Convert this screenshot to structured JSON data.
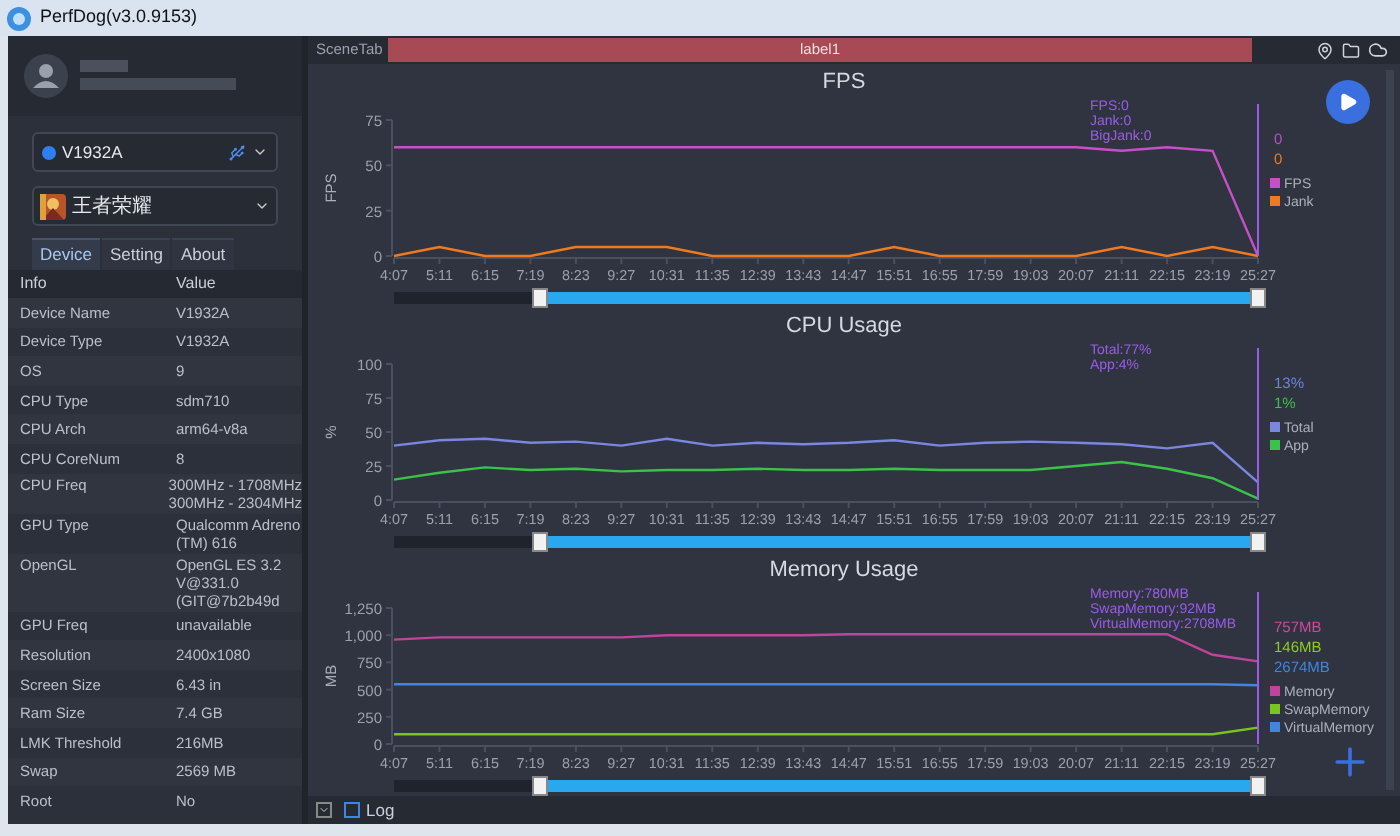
{
  "window": {
    "title": "PerfDog(v3.0.9153)"
  },
  "sidebar": {
    "device_selector": {
      "label": "V1932A"
    },
    "app_selector": {
      "label": "王者荣耀"
    },
    "tabs": [
      {
        "label": "Device",
        "selected": true
      },
      {
        "label": "Setting",
        "selected": false
      },
      {
        "label": "About",
        "selected": false
      }
    ],
    "table": {
      "columns": [
        "Info",
        "Value"
      ],
      "rows": [
        {
          "label": "Device Name",
          "value": [
            "V1932A"
          ]
        },
        {
          "label": "Device Type",
          "value": [
            "V1932A"
          ]
        },
        {
          "label": "OS",
          "value": [
            "9"
          ]
        },
        {
          "label": "CPU Type",
          "value": [
            "sdm710"
          ]
        },
        {
          "label": "CPU Arch",
          "value": [
            "arm64-v8a"
          ]
        },
        {
          "label": "CPU CoreNum",
          "value": [
            "8"
          ]
        },
        {
          "label": "CPU Freq",
          "value": [
            "300MHz - 1708MHz",
            "300MHz - 2304MHz"
          ]
        },
        {
          "label": "GPU Type",
          "value": [
            "Qualcomm Adreno",
            "(TM) 616"
          ]
        },
        {
          "label": "OpenGL",
          "value": [
            "OpenGL ES 3.2",
            "V@331.0",
            "(GIT@7b2b49d"
          ]
        },
        {
          "label": "GPU Freq",
          "value": [
            "unavailable"
          ]
        },
        {
          "label": "Resolution",
          "value": [
            "2400x1080"
          ]
        },
        {
          "label": "Screen Size",
          "value": [
            "6.43 in"
          ]
        },
        {
          "label": "Ram Size",
          "value": [
            "7.4 GB"
          ]
        },
        {
          "label": "LMK Threshold",
          "value": [
            "216MB"
          ]
        },
        {
          "label": "Swap",
          "value": [
            "2569 MB"
          ]
        },
        {
          "label": "Root",
          "value": [
            "No"
          ]
        }
      ]
    }
  },
  "scene_bar": {
    "tab": "SceneTab",
    "label": "label1"
  },
  "charts": [
    {
      "current_values": [
        {
          "text": "0",
          "color": "#b54fd0"
        },
        {
          "text": "0",
          "color": "#f07a22"
        }
      ],
      "slider": {
        "level": 0.83
      },
      "chart_data": {
        "type": "line",
        "title": "FPS",
        "ylabel": "FPS",
        "categories": [
          "4:07",
          "5:11",
          "6:15",
          "7:19",
          "8:23",
          "9:27",
          "10:31",
          "11:35",
          "12:39",
          "13:43",
          "14:47",
          "15:51",
          "16:55",
          "17:59",
          "19:03",
          "20:07",
          "21:11",
          "22:15",
          "23:19",
          "25:27"
        ],
        "ylim": [
          0,
          75
        ],
        "yticks": [
          0,
          25,
          50,
          75
        ],
        "annotations": [
          "FPS:0",
          "Jank:0",
          "BigJank:0"
        ],
        "series": [
          {
            "name": "FPS",
            "color": "#c74fc7",
            "values": [
              60,
              60,
              60,
              60,
              60,
              60,
              60,
              60,
              60,
              60,
              60,
              60,
              60,
              60,
              60,
              60,
              58,
              60,
              58,
              0
            ]
          },
          {
            "name": "Jank",
            "color": "#f07a22",
            "values": [
              0,
              5,
              0,
              0,
              5,
              5,
              5,
              0,
              0,
              0,
              0,
              5,
              0,
              0,
              0,
              0,
              5,
              0,
              5,
              0
            ]
          }
        ],
        "legend": "right",
        "ref_lines": [
          {
            "axis": "x",
            "value": "25:27",
            "color": "#9a5ce8"
          }
        ]
      }
    },
    {
      "current_values": [
        {
          "text": "13%",
          "color": "#6d83e0"
        },
        {
          "text": "1%",
          "color": "#3cc14a"
        }
      ],
      "slider": {
        "level": 0.83
      },
      "chart_data": {
        "type": "line",
        "title": "CPU Usage",
        "ylabel": "%",
        "categories": [
          "4:07",
          "5:11",
          "6:15",
          "7:19",
          "8:23",
          "9:27",
          "10:31",
          "11:35",
          "12:39",
          "13:43",
          "14:47",
          "15:51",
          "16:55",
          "17:59",
          "19:03",
          "20:07",
          "21:11",
          "22:15",
          "23:19",
          "25:27"
        ],
        "ylim": [
          0,
          100
        ],
        "yticks": [
          0,
          25,
          50,
          75,
          100
        ],
        "annotations": [
          "Total:77%",
          "App:4%"
        ],
        "series": [
          {
            "name": "Total",
            "color": "#7b86e0",
            "values": [
              40,
              44,
              45,
              42,
              43,
              40,
              45,
              40,
              42,
              41,
              42,
              44,
              40,
              42,
              43,
              42,
              41,
              38,
              42,
              13
            ]
          },
          {
            "name": "App",
            "color": "#3cc14a",
            "values": [
              15,
              20,
              24,
              22,
              23,
              21,
              22,
              22,
              23,
              22,
              22,
              23,
              22,
              22,
              22,
              25,
              28,
              23,
              16,
              1
            ]
          }
        ],
        "legend": "right",
        "ref_lines": [
          {
            "axis": "x",
            "value": "25:27",
            "color": "#9a5ce8"
          }
        ]
      }
    },
    {
      "current_values": [
        {
          "text": "757MB",
          "color": "#d0489e"
        },
        {
          "text": "146MB",
          "color": "#8ccf1f"
        },
        {
          "text": "2674MB",
          "color": "#3f86e0"
        }
      ],
      "slider": {
        "level": 0.83
      },
      "chart_data": {
        "type": "line",
        "title": "Memory Usage",
        "ylabel": "MB",
        "categories": [
          "4:07",
          "5:11",
          "6:15",
          "7:19",
          "8:23",
          "9:27",
          "10:31",
          "11:35",
          "12:39",
          "13:43",
          "14:47",
          "15:51",
          "16:55",
          "17:59",
          "19:03",
          "20:07",
          "21:11",
          "22:15",
          "23:19",
          "25:27"
        ],
        "ylim": [
          0,
          1250
        ],
        "yticks": [
          0,
          250,
          500,
          750,
          {
            "value": 1000,
            "label": "1,000"
          },
          {
            "value": 1250,
            "label": "1,250"
          }
        ],
        "annotations": [
          "Memory:780MB",
          "SwapMemory:92MB",
          "VirtualMemory:2708MB"
        ],
        "series": [
          {
            "name": "Memory",
            "color": "#c0449c",
            "values": [
              960,
              980,
              980,
              980,
              980,
              980,
              1000,
              1000,
              1000,
              1000,
              1010,
              1010,
              1010,
              1010,
              1010,
              1010,
              1010,
              1010,
              820,
              760
            ]
          },
          {
            "name": "SwapMemory",
            "color": "#7ac41f",
            "values": [
              90,
              90,
              90,
              90,
              90,
              90,
              90,
              90,
              90,
              90,
              90,
              90,
              90,
              90,
              90,
              90,
              90,
              90,
              90,
              150
            ]
          },
          {
            "name": "VirtualMemory",
            "color": "#3f86e0",
            "values": [
              550,
              550,
              550,
              550,
              550,
              550,
              550,
              550,
              550,
              550,
              550,
              550,
              550,
              550,
              550,
              550,
              550,
              550,
              550,
              540
            ]
          }
        ],
        "legend": "right",
        "ref_lines": [
          {
            "axis": "x",
            "value": "25:27",
            "color": "#9a5ce8"
          }
        ]
      }
    }
  ],
  "bottom_bar": {
    "log": {
      "label": "Log",
      "checked": false
    }
  }
}
